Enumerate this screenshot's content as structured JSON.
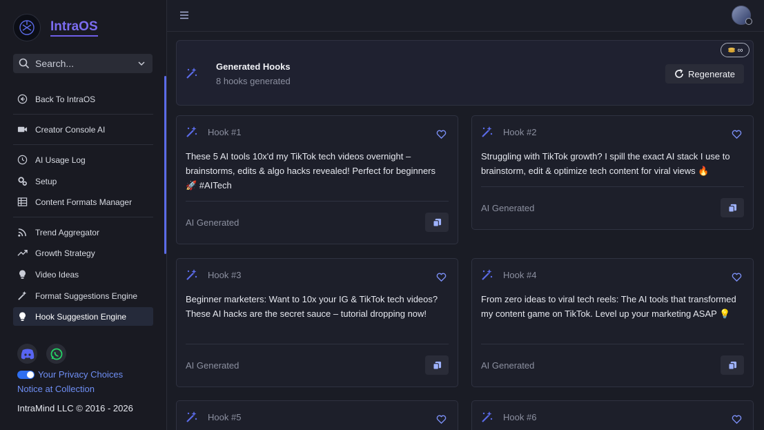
{
  "brand": {
    "name": "IntraOS"
  },
  "search": {
    "placeholder": "Search..."
  },
  "nav": {
    "back": "Back To IntraOS",
    "creator_console": "Creator Console AI",
    "usage_log": "AI Usage Log",
    "setup": "Setup",
    "content_formats": "Content Formats Manager",
    "trend_aggregator": "Trend Aggregator",
    "growth_strategy": "Growth Strategy",
    "video_ideas": "Video Ideas",
    "format_suggestions": "Format Suggestions Engine",
    "hook_suggestion": "Hook Suggestion Engine"
  },
  "footer": {
    "privacy": "Your Privacy Choices",
    "notice": "Notice at Collection",
    "copyright": "IntraMind LLC © 2016 - 2026"
  },
  "header": {
    "title": "Generated Hooks",
    "subtitle": "8 hooks generated",
    "regenerate": "Regenerate",
    "credits": "∞"
  },
  "hooks": [
    {
      "number": "Hook #1",
      "text": "These 5 AI tools 10x'd my TikTok tech videos overnight – brainstorms, edits & algo hacks revealed! Perfect for beginners 🚀 #AITech",
      "footer": "AI Generated"
    },
    {
      "number": "Hook #2",
      "text": "Struggling with TikTok growth? I spill the exact AI stack I use to brainstorm, edit & optimize tech content for viral views 🔥",
      "footer": "AI Generated"
    },
    {
      "number": "Hook #3",
      "text": "Beginner marketers: Want to 10x your IG & TikTok tech videos? These AI hacks are the secret sauce – tutorial dropping now!",
      "footer": "AI Generated"
    },
    {
      "number": "Hook #4",
      "text": "From zero ideas to viral tech reels: The AI tools that transformed my content game on TikTok. Level up your marketing ASAP 💡",
      "footer": "AI Generated"
    },
    {
      "number": "Hook #5",
      "text": "",
      "footer": ""
    },
    {
      "number": "Hook #6",
      "text": "",
      "footer": ""
    }
  ],
  "colors": {
    "accent": "#7b6cf0",
    "link": "#6f8ff5",
    "icon_blue": "#5b6be8",
    "background": "#1a1c25"
  }
}
